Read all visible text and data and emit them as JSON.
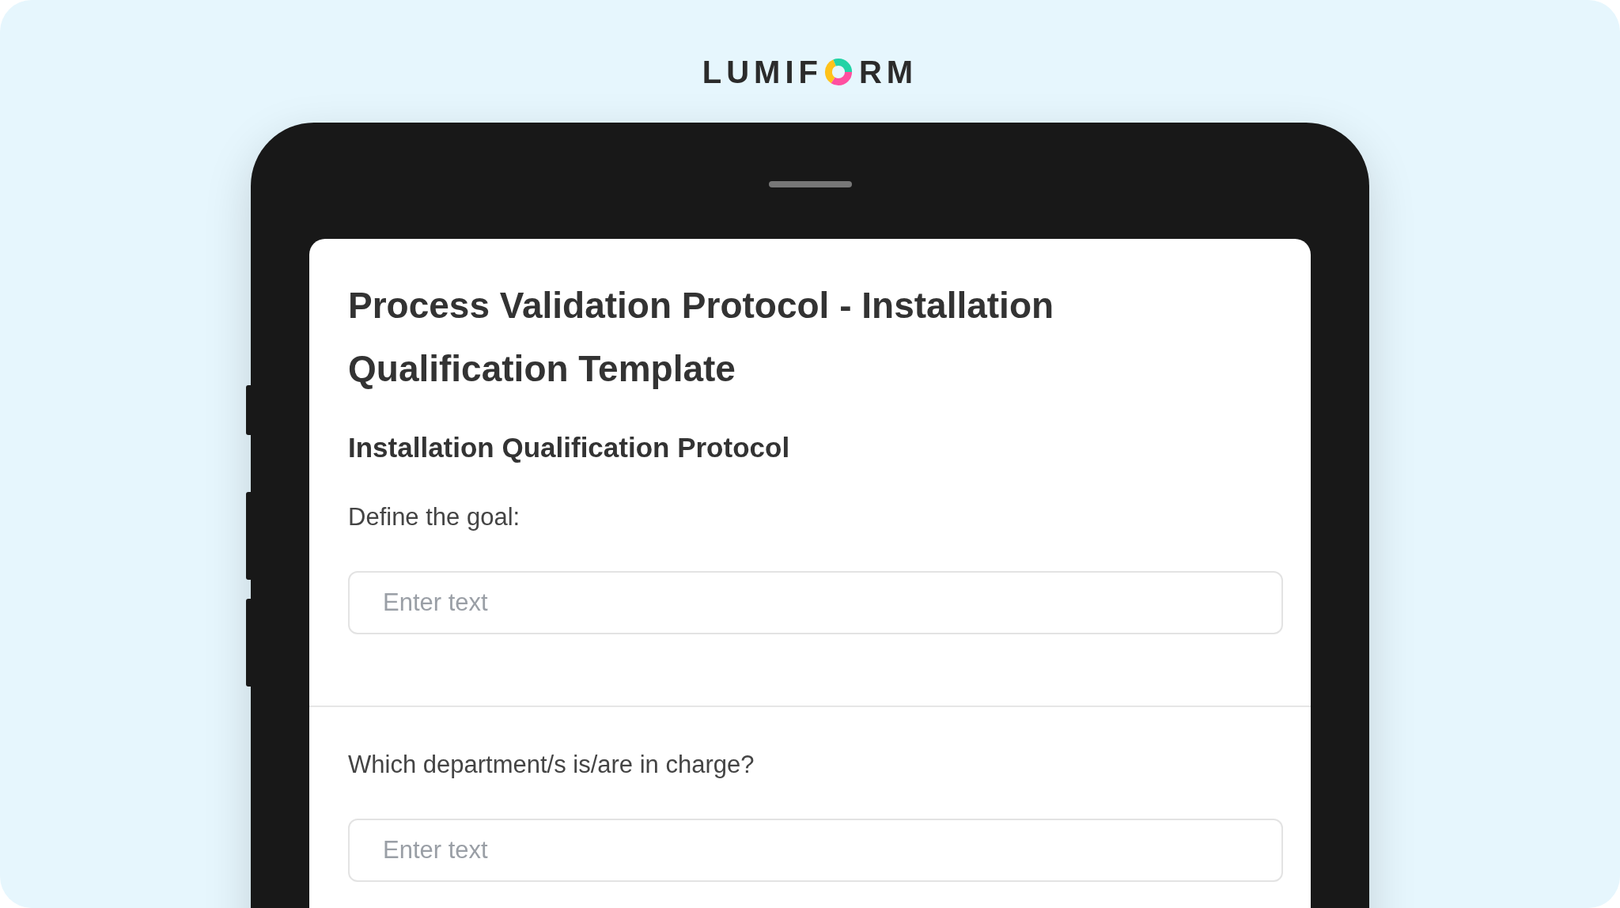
{
  "logo": {
    "parts": [
      "LUMIF",
      "RM"
    ]
  },
  "form": {
    "title": "Process Validation Protocol - Installation Qualification Template",
    "section": "Installation Qualification Protocol",
    "questions": [
      {
        "label": "Define the goal:",
        "placeholder": "Enter text"
      },
      {
        "label": "Which department/s is/are in charge?",
        "placeholder": "Enter text"
      }
    ]
  }
}
